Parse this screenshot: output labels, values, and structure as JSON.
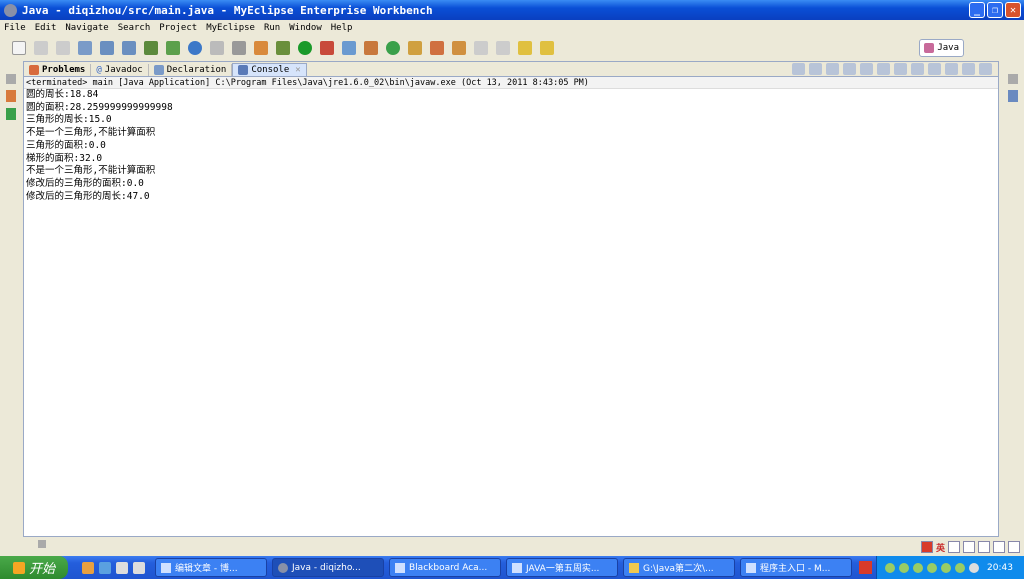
{
  "window": {
    "title": "Java - diqizhou/src/main.java - MyEclipse Enterprise Workbench"
  },
  "menu": [
    "File",
    "Edit",
    "Navigate",
    "Search",
    "Project",
    "MyEclipse",
    "Run",
    "Window",
    "Help"
  ],
  "perspective": {
    "label": "Java"
  },
  "tabs": [
    {
      "label": "Problems"
    },
    {
      "label": "Javadoc"
    },
    {
      "label": "Declaration"
    },
    {
      "label": "Console",
      "close": "✕"
    }
  ],
  "console": {
    "status": "<terminated> main [Java Application] C:\\Program Files\\Java\\jre1.6.0_02\\bin\\javaw.exe (Oct 13, 2011 8:43:05 PM)",
    "lines": [
      "圆的周长:18.84",
      "圆的面积:28.259999999999998",
      "三角形的周长:15.0",
      "不是一个三角形,不能计算面积",
      "三角形的面积:0.0",
      "梯形的面积:32.0",
      "不是一个三角形,不能计算面积",
      "修改后的三角形的面积:0.0",
      "修改后的三角形的周长:47.0"
    ]
  },
  "taskbar": {
    "start": "开始",
    "tasks": [
      "编辑文章 - 博...",
      "Java - diqizho...",
      "Blackboard Aca...",
      "JAVA一第五周实...",
      "G:\\Java第二次\\...",
      "程序主入口 - M..."
    ],
    "active_index": 1,
    "clock": "20:43",
    "ime": "英"
  }
}
